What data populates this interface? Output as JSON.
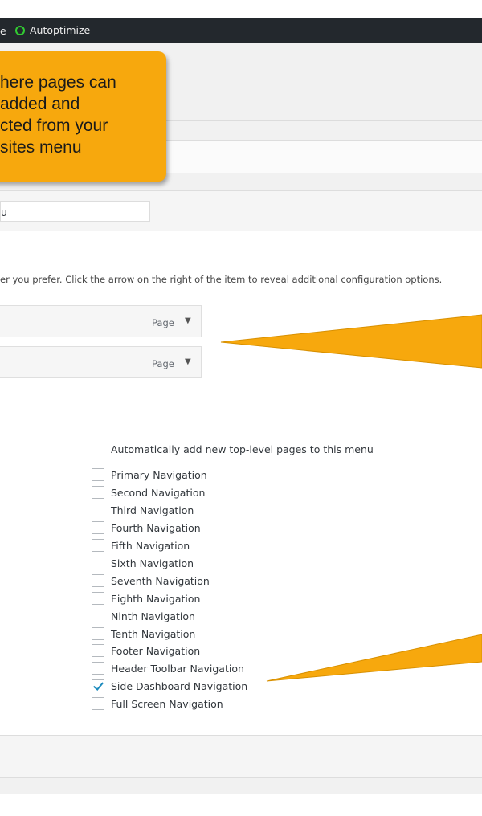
{
  "admin_bar": {
    "fragment": "e",
    "plugin_label": "Autoptimize",
    "plugin_status_color": "#32cd32"
  },
  "callout": {
    "lines": [
      "here pages can",
      "added and",
      "cted from your",
      "sites menu"
    ],
    "color": "#f7a80d"
  },
  "menu_name": {
    "value": "u"
  },
  "structure": {
    "instructions": "er you prefer. Click the arrow on the right of the item to reveal additional configuration options.",
    "items": [
      {
        "type": "Page",
        "arrow": "▼"
      },
      {
        "type": "Page",
        "arrow": "▼"
      }
    ]
  },
  "settings": {
    "auto_add_label": "Automatically add new top-level pages to this menu",
    "auto_add_checked": false,
    "locations": [
      {
        "label": "Primary Navigation",
        "checked": false
      },
      {
        "label": "Second Navigation",
        "checked": false
      },
      {
        "label": "Third Navigation",
        "checked": false
      },
      {
        "label": "Fourth Navigation",
        "checked": false
      },
      {
        "label": "Fifth Navigation",
        "checked": false
      },
      {
        "label": "Sixth Navigation",
        "checked": false
      },
      {
        "label": "Seventh Navigation",
        "checked": false
      },
      {
        "label": "Eighth Navigation",
        "checked": false
      },
      {
        "label": "Ninth Navigation",
        "checked": false
      },
      {
        "label": "Tenth Navigation",
        "checked": false
      },
      {
        "label": "Footer Navigation",
        "checked": false
      },
      {
        "label": "Header Toolbar Navigation",
        "checked": false
      },
      {
        "label": "Side Dashboard Navigation",
        "checked": true
      },
      {
        "label": "Full Screen Navigation",
        "checked": false
      }
    ]
  },
  "colors": {
    "admin_bar_bg": "#23282d",
    "checkbox_check": "#1e8cbe",
    "annotation": "#f7a80d"
  }
}
